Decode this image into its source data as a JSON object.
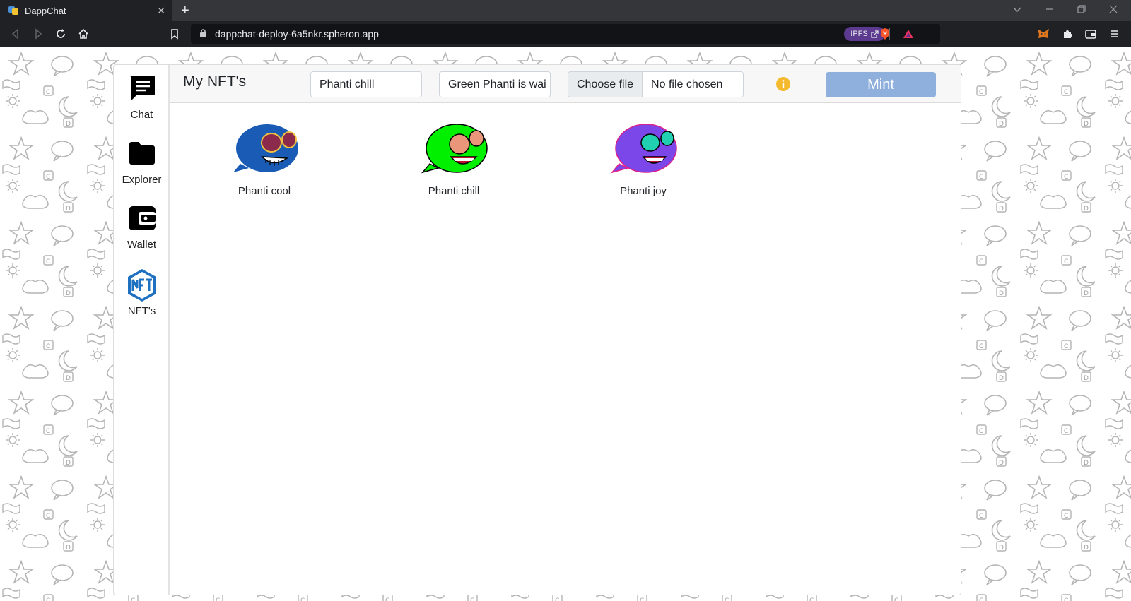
{
  "browser": {
    "tab_title": "DappChat",
    "tab_close": "✕",
    "new_tab": "+",
    "url": "dappchat-deploy-6a5nkr.spheron.app",
    "ipfs_badge": "IPFS"
  },
  "sidebar": {
    "items": [
      {
        "label": "Chat",
        "icon": "chat-icon"
      },
      {
        "label": "Explorer",
        "icon": "folder-icon"
      },
      {
        "label": "Wallet",
        "icon": "wallet-icon"
      },
      {
        "label": "NFT's",
        "icon": "nft-icon"
      }
    ]
  },
  "header": {
    "title": "My NFT's",
    "name_value": "Phanti chill",
    "description_value": "Green Phanti is wai",
    "file_button": "Choose file",
    "file_status": "No file chosen",
    "mint_label": "Mint"
  },
  "nfts": [
    {
      "name": "Phanti cool",
      "color": "#1a5bb5",
      "eye_color": "#8b2a4a",
      "mouth": "teeth"
    },
    {
      "name": "Phanti chill",
      "color": "#00f000",
      "eye_color": "#e9967a",
      "mouth": "open"
    },
    {
      "name": "Phanti joy",
      "color": "#7b47e8",
      "eye_color": "#20d0b0",
      "mouth": "open"
    }
  ],
  "colors": {
    "mint_button": "#8fb0dc",
    "info_icon": "#f5b92e",
    "browser_bg": "#202124"
  }
}
